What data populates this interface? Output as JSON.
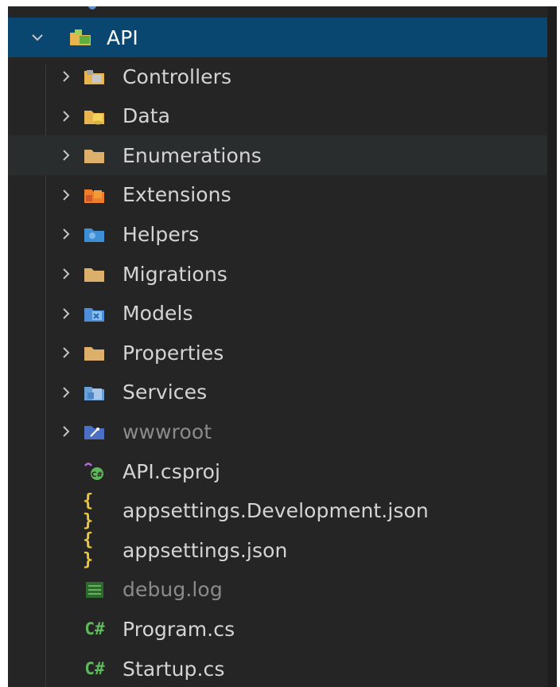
{
  "explorer": {
    "root": {
      "label": "API",
      "expanded": true,
      "icon": "folder-project-icon"
    },
    "items": [
      {
        "label": "Controllers",
        "type": "folder",
        "icon": "folder-controllers-icon",
        "color": "#e8b44f"
      },
      {
        "label": "Data",
        "type": "folder",
        "icon": "folder-database-icon",
        "color": "#e8b44f"
      },
      {
        "label": "Enumerations",
        "type": "folder",
        "icon": "folder-icon",
        "color": "#dcb06a"
      },
      {
        "label": "Extensions",
        "type": "folder",
        "icon": "folder-extensions-icon",
        "color": "#ee7d2c"
      },
      {
        "label": "Helpers",
        "type": "folder",
        "icon": "folder-helpers-icon",
        "color": "#3d8fd6"
      },
      {
        "label": "Migrations",
        "type": "folder",
        "icon": "folder-icon",
        "color": "#dcb06a"
      },
      {
        "label": "Models",
        "type": "folder",
        "icon": "folder-models-icon",
        "color": "#4f8ed8"
      },
      {
        "label": "Properties",
        "type": "folder",
        "icon": "folder-icon",
        "color": "#dcb06a"
      },
      {
        "label": "Services",
        "type": "folder",
        "icon": "folder-services-icon",
        "color": "#6aa0d8"
      },
      {
        "label": "wwwroot",
        "type": "folder",
        "icon": "folder-wwwroot-icon",
        "color": "#4a6fc4",
        "dimmed": true
      },
      {
        "label": "API.csproj",
        "type": "file",
        "icon": "csproj-file-icon"
      },
      {
        "label": "appsettings.Development.json",
        "type": "file",
        "icon": "json-file-icon",
        "glyph": "{ }"
      },
      {
        "label": "appsettings.json",
        "type": "file",
        "icon": "json-file-icon",
        "glyph": "{ }"
      },
      {
        "label": "debug.log",
        "type": "file",
        "icon": "log-file-icon",
        "dimmed": true
      },
      {
        "label": "Program.cs",
        "type": "file",
        "icon": "csharp-file-icon",
        "glyph": "C#"
      },
      {
        "label": "Startup.cs",
        "type": "file",
        "icon": "csharp-file-icon",
        "glyph": "C#"
      }
    ]
  },
  "colors": {
    "background": "#252526",
    "selection": "#094771",
    "hover": "#2a2d2e",
    "text": "#d4d4d4",
    "dim_text": "#8b8b8b"
  }
}
